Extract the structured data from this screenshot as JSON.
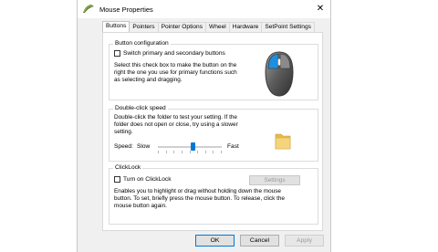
{
  "window": {
    "title": "Mouse Properties",
    "close_glyph": "✕"
  },
  "tabs": [
    {
      "label": "Buttons",
      "active": true
    },
    {
      "label": "Pointers",
      "active": false
    },
    {
      "label": "Pointer Options",
      "active": false
    },
    {
      "label": "Wheel",
      "active": false
    },
    {
      "label": "Hardware",
      "active": false
    },
    {
      "label": "SetPoint Settings",
      "active": false
    }
  ],
  "button_config": {
    "title": "Button configuration",
    "checkbox_label": "Switch primary and secondary buttons",
    "checked": false,
    "description_lines": [
      "Select this check box to make the button on the",
      "right the one you use for primary functions such",
      "as selecting and dragging."
    ],
    "icon": "mouse-icon"
  },
  "double_click": {
    "title": "Double-click speed",
    "description_lines": [
      "Double-click the folder to test your setting. If the",
      "folder does not open or close, try using a slower",
      "setting."
    ],
    "speed_label": "Speed:",
    "slow_label": "Slow",
    "fast_label": "Fast",
    "slider_value_fraction": 0.55,
    "icon": "folder-icon"
  },
  "clicklock": {
    "title": "ClickLock",
    "checkbox_label": "Turn on ClickLock",
    "checked": false,
    "settings_label": "Settings",
    "description_lines": [
      "Enables you to highlight or drag without holding down the mouse",
      "button. To set, briefly press the mouse button. To release, click the",
      "mouse button again."
    ]
  },
  "buttons": {
    "ok": "OK",
    "cancel": "Cancel",
    "apply": "Apply"
  },
  "colors": {
    "accent": "#0078d7",
    "folder": "#f4d47c"
  }
}
